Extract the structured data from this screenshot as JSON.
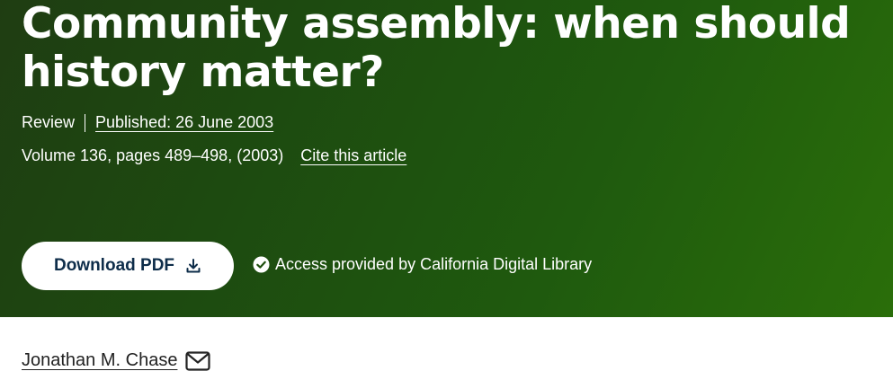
{
  "article": {
    "title": "Community assembly: when should history matter?",
    "type": "Review",
    "published": "Published: 26 June 2003",
    "volume_info": "Volume 136, pages 489–498, (2003)",
    "cite_label": "Cite this article"
  },
  "actions": {
    "download_label": "Download PDF",
    "download_icon": "download-icon"
  },
  "access": {
    "text": "Access provided by California Digital Library",
    "icon": "check-circle-icon"
  },
  "authors": [
    {
      "name": "Jonathan M. Chase",
      "icon": "mail-icon"
    }
  ],
  "colors": {
    "hero_start": "#1f3d12",
    "hero_end": "#2a6e0a",
    "button_text": "#0e2d4a"
  }
}
